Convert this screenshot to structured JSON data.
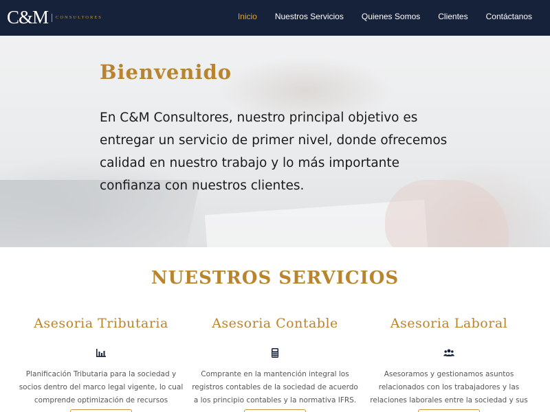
{
  "brand": {
    "mark": "C&M",
    "subtitle": "CONSULTORES"
  },
  "nav": {
    "items": [
      {
        "label": "Inicio",
        "active": true
      },
      {
        "label": "Nuestros Servicios",
        "active": false
      },
      {
        "label": "Quienes Somos",
        "active": false
      },
      {
        "label": "Clientes",
        "active": false
      },
      {
        "label": "Contáctanos",
        "active": false
      }
    ]
  },
  "hero": {
    "title": "Bienvenido",
    "text": "En C&M Consultores, nuestro principal objetivo es entregar un servicio de primer nivel, donde ofrecemos calidad en nuestro trabajo y lo más importante confianza con nuestros clientes."
  },
  "services": {
    "title": "NUESTROS SERVICIOS",
    "items": [
      {
        "title": "Asesoria Tributaria",
        "icon": "bar-chart-icon",
        "text": "Planificación Tributaria para la sociedad y socios dentro del marco legal vigente, lo cual comprende optimización de recursos económicos."
      },
      {
        "title": "Asesoria Contable",
        "icon": "calculator-icon",
        "text": "Comprante en la mantención integral los registros contables de la sociedad de acuerdo a los principio contables y la normativa IFRS."
      },
      {
        "title": "Asesoria Laboral",
        "icon": "users-icon",
        "text": "Asesoramos y gestionamos asuntos relacionados con los trabajadores y las relaciones laborales entre la sociedad y sus empleados."
      }
    ]
  },
  "colors": {
    "navbar": "#16213a",
    "accent": "#b8842d",
    "nav_active": "#e0a437"
  }
}
